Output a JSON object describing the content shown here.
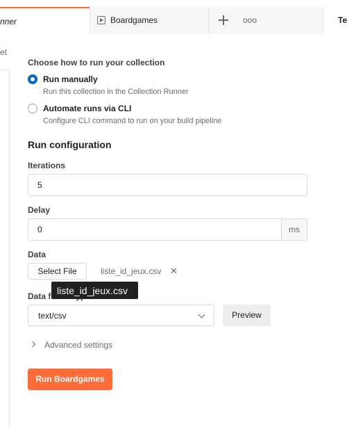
{
  "tabs": {
    "active_label": "nner",
    "second_label": "Boardgames",
    "third_label": "Te",
    "more_label": "ooo"
  },
  "left": {
    "fragment": "et"
  },
  "run_mode": {
    "title": "Choose how to run your collection",
    "options": [
      {
        "title": "Run manually",
        "description": "Run this collection in the Collection Runner",
        "selected": true
      },
      {
        "title": "Automate runs via CLI",
        "description": "Configure CLI command to run on your build pipeline",
        "selected": false
      }
    ]
  },
  "config": {
    "heading": "Run configuration",
    "iterations_label": "Iterations",
    "iterations_value": "5",
    "delay_label": "Delay",
    "delay_value": "0",
    "delay_unit": "ms",
    "data_label": "Data",
    "select_file_label": "Select File",
    "file_name": "liste_id_jeux.csv",
    "tooltip": "liste_id_jeux.csv",
    "data_type_label": "Data f",
    "data_type_label_tail": "ype",
    "data_type_value": "text/csv",
    "preview_label": "Preview",
    "advanced_label": "Advanced settings",
    "run_button": "Run Boardgames"
  },
  "colors": {
    "accent": "#ff6c37",
    "radio_selected": "#0265d2"
  }
}
